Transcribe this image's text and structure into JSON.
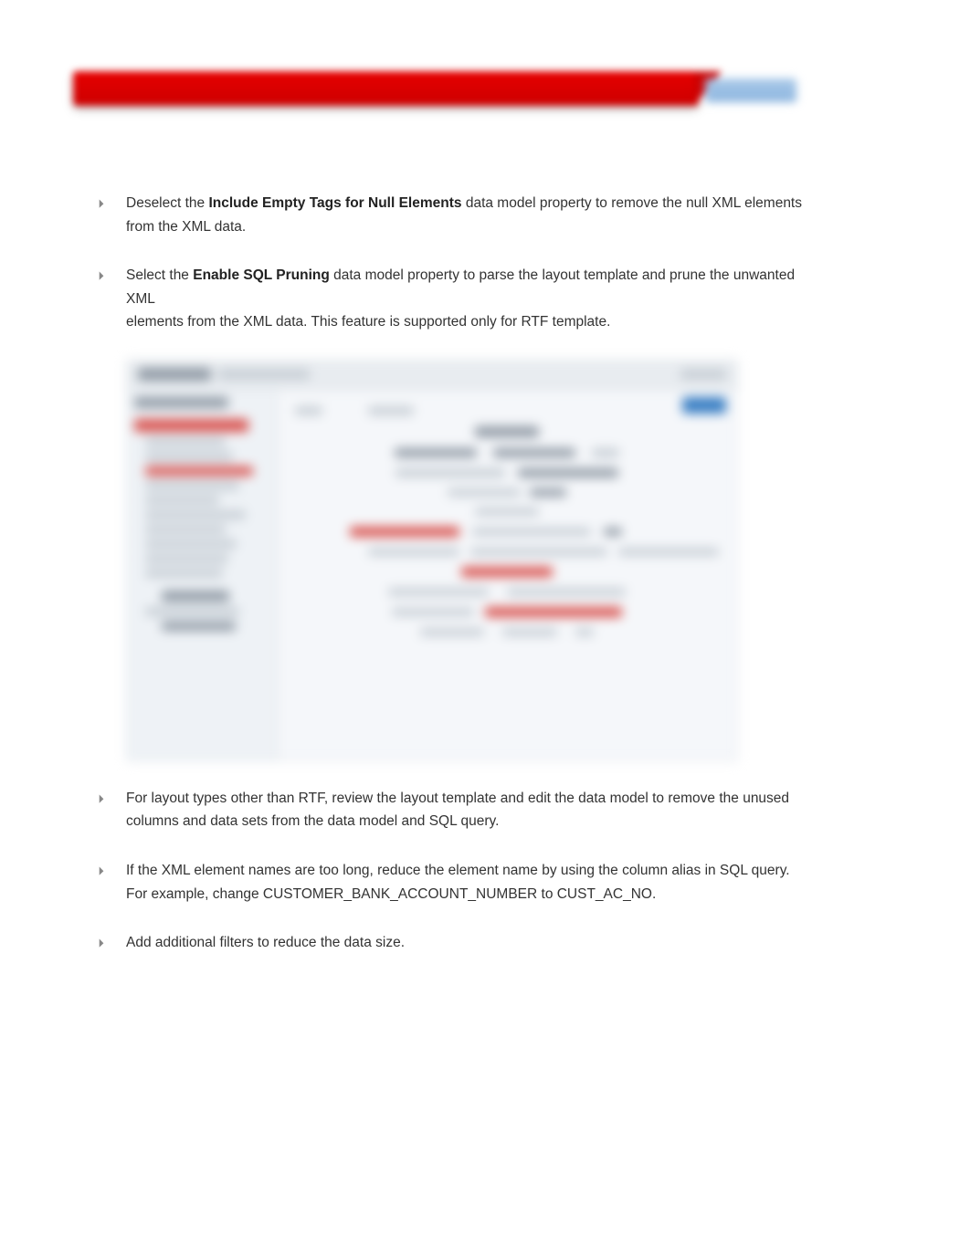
{
  "bullets": [
    {
      "pre": "Deselect the ",
      "bold": "Include Empty Tags for Null Elements",
      "post": " data model property to remove the null XML elements from the XML data."
    },
    {
      "pre": "Select the ",
      "bold": "Enable SQL Pruning",
      "post": " data model property to parse the layout template and prune the unwanted XML",
      "post2": "elements from the XML data. This feature is supported only for RTF template."
    },
    {
      "pre": "",
      "bold": "",
      "post": "For layout types other than RTF, review the layout template and edit the data model to remove the unused columns and data sets from the data model and SQL query."
    },
    {
      "pre": "",
      "bold": "",
      "post": "If the XML element names are too long, reduce the element name by using the column alias in SQL query. For example, change CUSTOMER_BANK_ACCOUNT_NUMBER to CUST_AC_NO."
    },
    {
      "pre": "",
      "bold": "",
      "post": "Add additional filters to reduce the data size."
    }
  ],
  "bullet_glyph": "🞂"
}
